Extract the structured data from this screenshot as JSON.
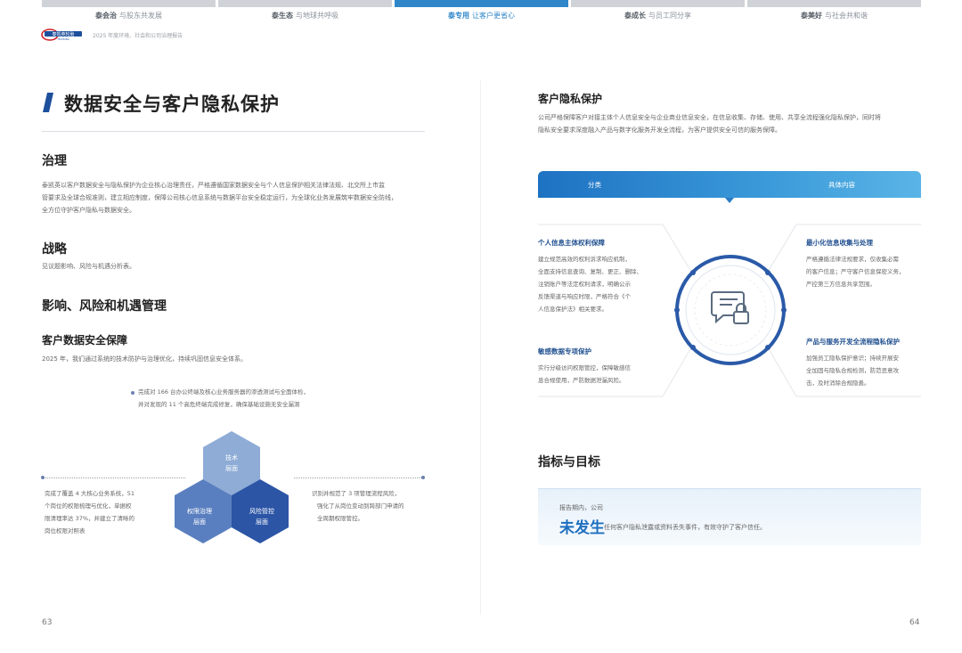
{
  "tabs": [
    {
      "head": "泰会治",
      "rest": "与股东共发展",
      "active": false
    },
    {
      "head": "泰生态",
      "rest": "与地球共呼吸",
      "active": false
    },
    {
      "head": "泰专用",
      "rest": "让客户更省心",
      "active": true
    },
    {
      "head": "泰成长",
      "rest": "与员工同分享",
      "active": false
    },
    {
      "head": "泰美好",
      "rest": "与社会共和谐",
      "active": false
    }
  ],
  "header": {
    "logo_text": "泰凯英轮胎",
    "logo_sub": "TECHKING",
    "report_subtitle": "2025 年度环境、社会和公司治理报告"
  },
  "left": {
    "title": "数据安全与客户隐私保护",
    "governance": {
      "heading": "治理",
      "text1": "泰凯英以客户数据安全与隐私保护为企业核心治理责任，严格遵循国家数据安全与个人信息保护相关法律法规、北交所上市监",
      "text2": "管要求及全球合规准则，建立相应制度，保障公司核心信息系统与数据平台安全稳定运行，为全球化业务发展筑牢数据安全防线，",
      "text3": "全方位守护客户隐私与数据安全。"
    },
    "strategy": {
      "heading": "战略",
      "text": "见议题影响、风险与机遇分析表。"
    },
    "iro": {
      "heading": "影响、风险和机遇管理"
    },
    "security": {
      "heading": "客户数据安全保障",
      "text": "2025 年，我们通过系统的技术防护与治理优化，持续巩固信息安全体系。"
    },
    "diagram": {
      "top_note1": "完成对 166 台办公终端及核心业务服务器的渗透测试与全面体检，",
      "top_note2": "并对发现的 11 个高危终端完成修复，确保基础设施无安全漏洞",
      "left_note1": "完成了覆盖 4 大核心业务系统，51",
      "left_note2": "个岗位的权限梳理与优化，单据权",
      "left_note3": "限清理率达 37%，并建立了清晰的",
      "left_note4": "岗位权限对照表",
      "right_note1": "识别并规范了 3 项管理流程风险，",
      "right_note2": "强化了从岗位变动到跨部门申请的",
      "right_note3": "全周期权限管控。",
      "hex_top_1": "技术",
      "hex_top_2": "层面",
      "hex_left_1": "权限治理",
      "hex_left_2": "层面",
      "hex_right_1": "风险管控",
      "hex_right_2": "层面"
    },
    "page_number": "63"
  },
  "right": {
    "privacy": {
      "heading": "客户隐私保护",
      "text1": "公司严格保障客户对接主体个人信息安全与企业商业信息安全，在信息收集、存储、使用、共享全流程强化隐私保护，同时将",
      "text2": "隐私安全要求深度融入产品与数字化服务开发全流程，为客户提供安全可信的服务保障。"
    },
    "table_head": {
      "col1": "分类",
      "col2": "具体内容"
    },
    "items": {
      "tl_title": "个人信息主体权利保障",
      "tl_1": "建立规范高效的权利诉求响应机制，",
      "tl_2": "全面支持信息查询、复制、更正、删除、",
      "tl_3": "注销账户等法定权利请求，明确公示",
      "tl_4": "反馈渠道与响应时限，严格符合《个",
      "tl_5": "人信息保护法》相关要求。",
      "tr_title": "最小化信息收集与处理",
      "tr_1": "严格遵循法律法规要求，仅收集必需",
      "tr_2": "的客户信息；严守客户信息保密义务，",
      "tr_3": "严控第三方信息共享范围。",
      "bl_title": "敏感数据专项保护",
      "bl_1": "实行分级访问权限管控，保障敏感信",
      "bl_2": "息合规使用，严防数据泄漏风险。",
      "br_title": "产品与服务开发全流程隐私保护",
      "br_1": "加强员工隐私保护意识；持续开展安",
      "br_2": "全加固与隐私合规检测，防范恶意攻",
      "br_3": "击，及时消除合规隐患。"
    },
    "indicators": {
      "heading": "指标与目标",
      "label": "报告期内，公司",
      "big": "未发生",
      "rest": "任何客户隐私泄露或资料丢失事件，有效守护了客户信任。"
    },
    "page_number": "64"
  },
  "colors": {
    "accent": "#2f86c9",
    "hex_light": "#8eacd6",
    "hex_mid": "#5a7fc0",
    "hex_dark": "#2c55a6",
    "ring": "#2a5aa8"
  }
}
